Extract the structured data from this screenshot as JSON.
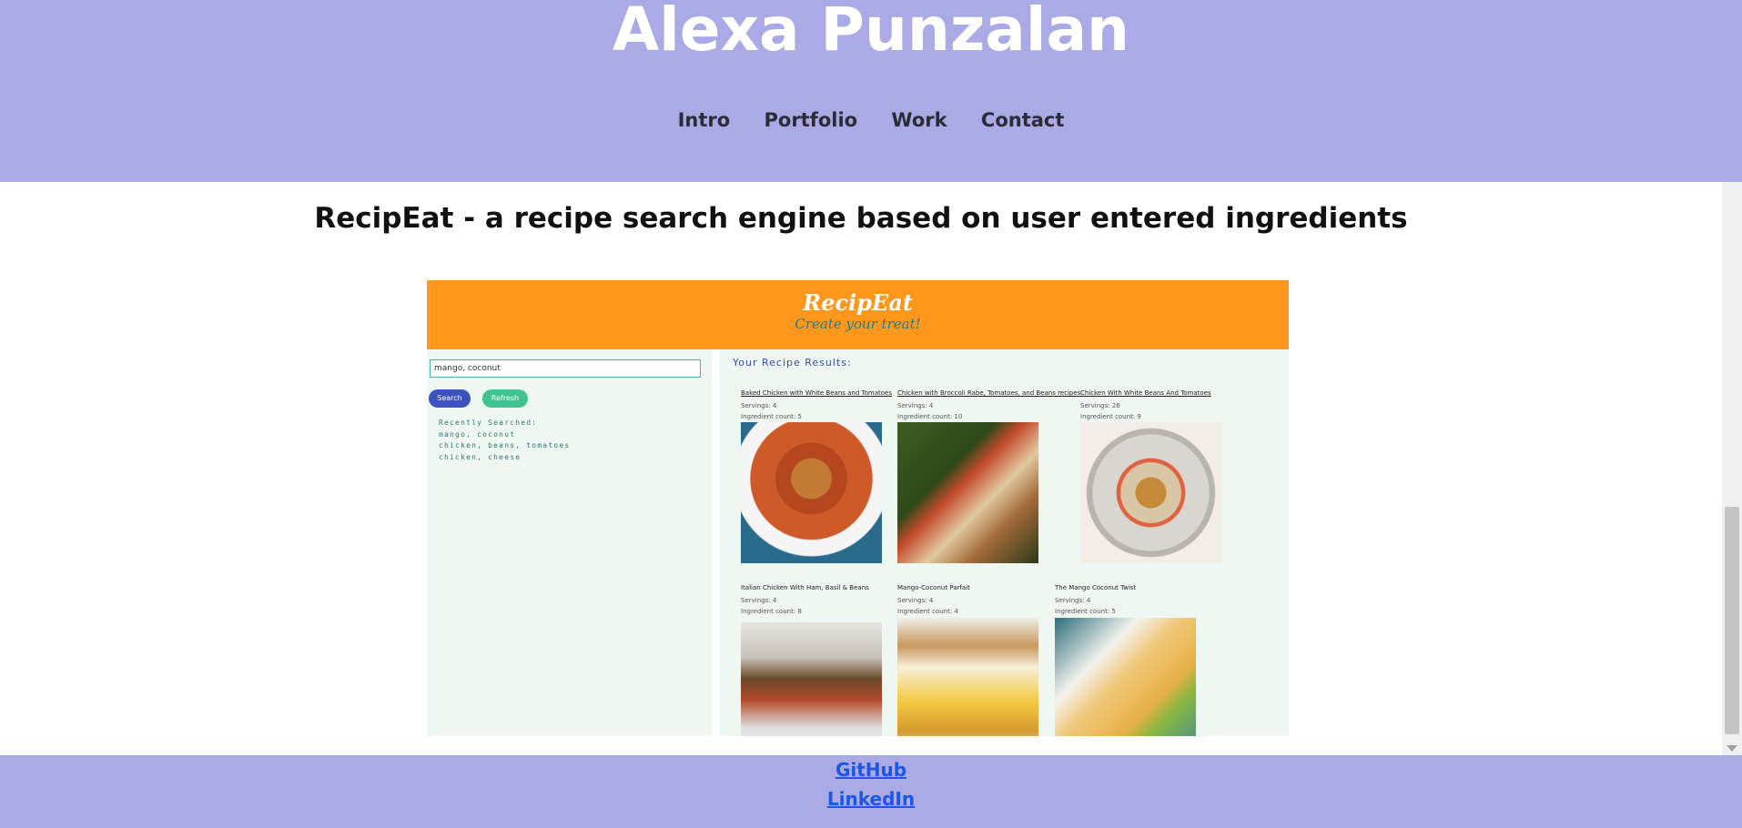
{
  "site": {
    "title": "Alexa Punzalan",
    "nav": [
      "Intro",
      "Portfolio",
      "Work",
      "Contact"
    ]
  },
  "project": {
    "title": "RecipEat - a recipe search engine based on user entered ingredients"
  },
  "screenshot": {
    "logo": "RecipEat",
    "tagline": "Create your treat!",
    "search_value": "mango, coconut",
    "search_button": "Search",
    "refresh_button": "Refresh",
    "recent_label": "Recently Searched:",
    "recent_items": [
      "mango, coconut",
      "chicken, beans, tomatoes",
      "chicken, cheese"
    ],
    "results_heading": "Your Recipe Results:",
    "recipes": [
      {
        "title": "Baked Chicken with White Beans and Tomatoes",
        "servings": "Servings: 4",
        "count": "Ingredient count: 5"
      },
      {
        "title": "Chicken with Broccoli Rabe, Tomatoes, and Beans recipes",
        "servings": "Servings: 4",
        "count": "Ingredient count: 10"
      },
      {
        "title": "Chicken With White Beans And Tomatoes",
        "servings": "Servings: 26",
        "count": "Ingredient count: 9"
      },
      {
        "title": "Italian Chicken With Ham, Basil & Beans",
        "servings": "Servings: 4",
        "count": "Ingredient count: 8"
      },
      {
        "title": "Mango-Coconut Parfait",
        "servings": "Servings: 4",
        "count": "Ingredient count: 4"
      },
      {
        "title": "The Mango Coconut Twist",
        "servings": "Servings: 4",
        "count": "Ingredient count: 5"
      }
    ]
  },
  "footer": {
    "links": [
      "GitHub",
      "LinkedIn"
    ]
  },
  "colors": {
    "header_bg": "#aaaae6",
    "shot_header_bg": "#fe971b",
    "link": "#1a56e8"
  }
}
